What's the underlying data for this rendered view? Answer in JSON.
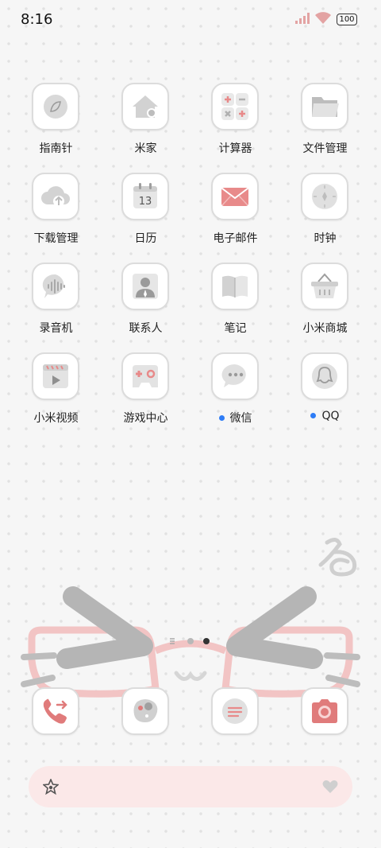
{
  "status_bar": {
    "time": "8:16",
    "battery": "100"
  },
  "apps": [
    {
      "label": "指南针",
      "icon": "compass-icon"
    },
    {
      "label": "米家",
      "icon": "mi-home-icon"
    },
    {
      "label": "计算器",
      "icon": "calculator-icon"
    },
    {
      "label": "文件管理",
      "icon": "folder-icon"
    },
    {
      "label": "下载管理",
      "icon": "cloud-download-icon"
    },
    {
      "label": "日历",
      "icon": "calendar-icon",
      "calendar_day": "13"
    },
    {
      "label": "电子邮件",
      "icon": "mail-icon"
    },
    {
      "label": "时钟",
      "icon": "clock-icon"
    },
    {
      "label": "录音机",
      "icon": "voice-recorder-icon"
    },
    {
      "label": "联系人",
      "icon": "contacts-icon"
    },
    {
      "label": "笔记",
      "icon": "notes-icon"
    },
    {
      "label": "小米商城",
      "icon": "shopping-basket-icon"
    },
    {
      "label": "小米视频",
      "icon": "video-player-icon"
    },
    {
      "label": "游戏中心",
      "icon": "gamepad-icon"
    },
    {
      "label": "微信",
      "icon": "wechat-icon",
      "new_indicator": true
    },
    {
      "label": "QQ",
      "icon": "qq-penguin-icon",
      "new_indicator": true
    }
  ],
  "dock": [
    {
      "icon": "phone-icon"
    },
    {
      "icon": "gallery-icon"
    },
    {
      "icon": "messages-icon"
    },
    {
      "icon": "camera-icon"
    }
  ],
  "pager": {
    "pages": 3,
    "current": 3
  },
  "search_bar": {
    "leading_icon": "star-icon",
    "trailing_icon": "heart-icon"
  },
  "colors": {
    "accent_pink": "#e88a8a",
    "indicator_blue": "#2e7cf6",
    "search_bg": "#fbe8e8"
  }
}
